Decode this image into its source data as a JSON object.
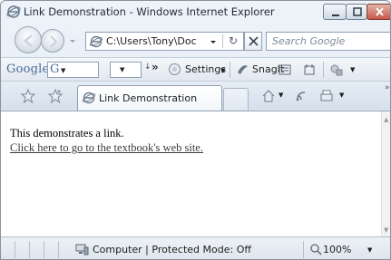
{
  "window": {
    "title": "Link Demonstration - Windows Internet Explorer"
  },
  "address_bar": {
    "url": "C:\\Users\\Tony\\Doc",
    "refresh_glyph": "↻"
  },
  "search": {
    "placeholder": "Search Google"
  },
  "google_toolbar": {
    "logo": "Google",
    "box_letter": "G",
    "more": "»",
    "settings_label": "Settings",
    "snagit_label": "SnagIt"
  },
  "tabs": [
    {
      "label": "Link Demonstration",
      "active": true
    }
  ],
  "command_bar": {
    "more": "»"
  },
  "page": {
    "text": "This demonstrates a link.",
    "link_text": "Click here to go to the textbook's web site."
  },
  "status_bar": {
    "zone": "Computer | Protected Mode: Off",
    "zoom": "100%"
  },
  "colors": {
    "frame": "#8a929c",
    "chrome_light": "#eef3f9",
    "chrome_dark": "#dbe6f2",
    "close_button": "#c9564a",
    "logo_blue": "#4a6a9a",
    "content_bg": "#ffffff",
    "link_color": "#3b3b3b"
  }
}
